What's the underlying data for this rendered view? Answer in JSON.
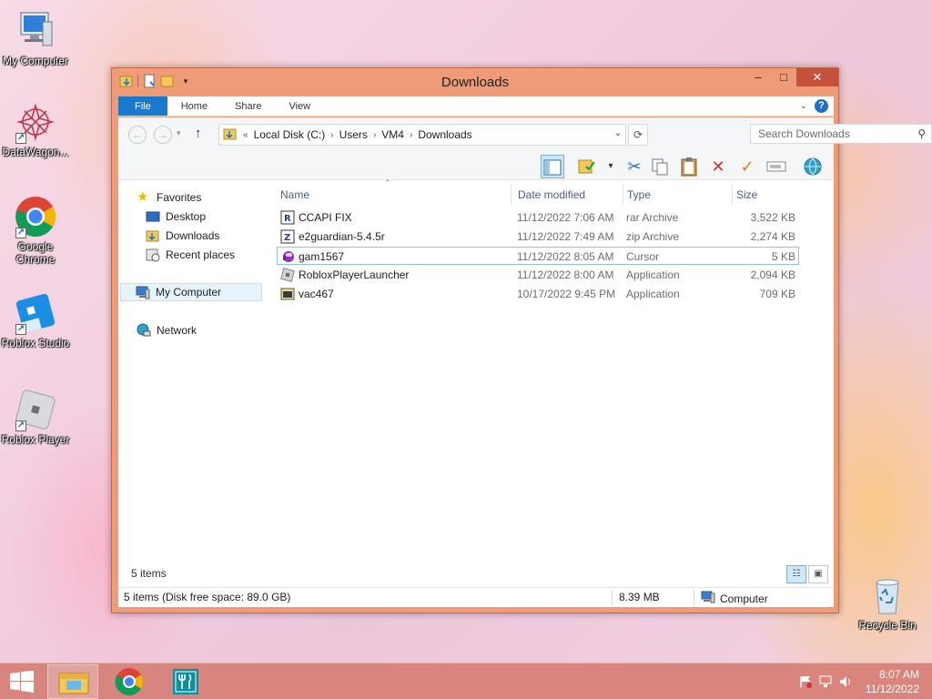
{
  "desktop": {
    "icons": [
      {
        "label": "My Computer"
      },
      {
        "label": "DataWagon..."
      },
      {
        "label": "Google Chrome"
      },
      {
        "label": "Roblox Studio"
      },
      {
        "label": "Roblox Player"
      },
      {
        "label": "Recycle Bin"
      }
    ]
  },
  "window": {
    "title": "Downloads",
    "controls": {
      "minimize": "–",
      "maximize": "□",
      "close": "✕"
    },
    "ribbon_tabs": [
      {
        "label": "File"
      },
      {
        "label": "Home"
      },
      {
        "label": "Share"
      },
      {
        "label": "View"
      }
    ],
    "address": {
      "prefix": "«",
      "crumbs": [
        "Local Disk (C:)",
        "Users",
        "VM4",
        "Downloads"
      ]
    },
    "search": {
      "placeholder": "Search Downloads"
    },
    "nav_pane": {
      "favorites_label": "Favorites",
      "favorites": [
        "Desktop",
        "Downloads",
        "Recent places"
      ],
      "my_computer": "My Computer",
      "network": "Network"
    },
    "columns": {
      "name": "Name",
      "date": "Date modified",
      "type": "Type",
      "size": "Size"
    },
    "files": [
      {
        "name": "CCAPI FIX",
        "date": "11/12/2022 7:06 AM",
        "type": "rar Archive",
        "size": "3,522 KB",
        "icon": "rar-archive-icon"
      },
      {
        "name": "e2guardian-5.4.5r",
        "date": "11/12/2022 7:49 AM",
        "type": "zip Archive",
        "size": "2,274 KB",
        "icon": "zip-archive-icon"
      },
      {
        "name": "gam1567",
        "date": "11/12/2022 8:05 AM",
        "type": "Cursor",
        "size": "5 KB",
        "icon": "cursor-file-icon"
      },
      {
        "name": "RobloxPlayerLauncher",
        "date": "11/12/2022 8:00 AM",
        "type": "Application",
        "size": "2,094 KB",
        "icon": "roblox-app-icon"
      },
      {
        "name": "vac467",
        "date": "10/17/2022 9:45 PM",
        "type": "Application",
        "size": "709 KB",
        "icon": "application-icon"
      }
    ],
    "item_count": "5 items",
    "status": {
      "summary": "5 items (Disk free space: 89.0 GB)",
      "size": "8.39 MB",
      "location": "Computer"
    }
  },
  "taskbar": {
    "time": "8:07 AM",
    "date": "11/12/2022"
  },
  "colors": {
    "window_frame": "#ef9b78",
    "file_tab": "#1979ca",
    "close_button": "#c7503a"
  }
}
